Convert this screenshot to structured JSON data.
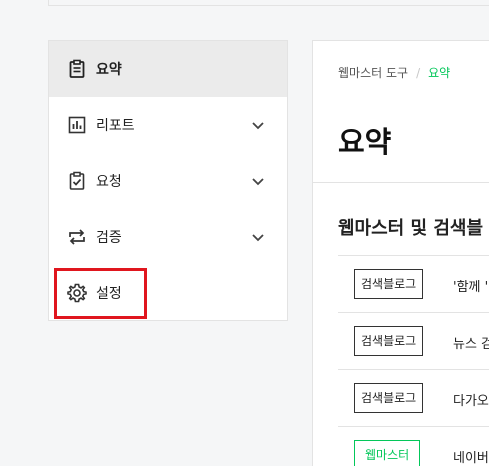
{
  "sidebar": {
    "items": [
      {
        "label": "요약",
        "icon": "clipboard-icon",
        "active": true,
        "expandable": false
      },
      {
        "label": "리포트",
        "icon": "bar-chart-icon",
        "active": false,
        "expandable": true
      },
      {
        "label": "요청",
        "icon": "clipboard-check-icon",
        "active": false,
        "expandable": true
      },
      {
        "label": "검증",
        "icon": "repeat-arrows-icon",
        "active": false,
        "expandable": true
      },
      {
        "label": "설정",
        "icon": "gear-icon",
        "active": false,
        "expandable": false
      }
    ],
    "highlighted_item": "설정",
    "highlight_color": "#e0161e"
  },
  "main": {
    "breadcrumb": {
      "root": "웹마스터 도구",
      "separator": "/",
      "current": "요약"
    },
    "title": "요약",
    "section_title": "웹마스터 및 검색블",
    "rows": [
      {
        "badge": "검색블로그",
        "badge_style": "default",
        "text": "'함께 '"
      },
      {
        "badge": "검색블로그",
        "badge_style": "default",
        "text": "뉴스 검"
      },
      {
        "badge": "검색블로그",
        "badge_style": "default",
        "text": "다가오"
      },
      {
        "badge": "웹마스터",
        "badge_style": "green",
        "text": "네이버"
      }
    ]
  },
  "colors": {
    "accent_green": "#03c75a",
    "active_bg": "#ebebeb",
    "border": "#e3e3e3"
  }
}
